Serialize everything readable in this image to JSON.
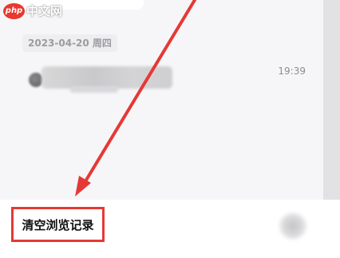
{
  "watermark": {
    "logo_text": "php",
    "site_text": "中文网"
  },
  "history": {
    "date": "2023-04-20 周四",
    "items": [
      {
        "time": "19:39"
      }
    ]
  },
  "bottom_bar": {
    "clear_label": "清空浏览记录"
  },
  "colors": {
    "highlight": "#e53935",
    "arrow": "#e53935"
  },
  "icons": {
    "item_icon": "site-favicon-icon",
    "more_button": "more-icon"
  }
}
